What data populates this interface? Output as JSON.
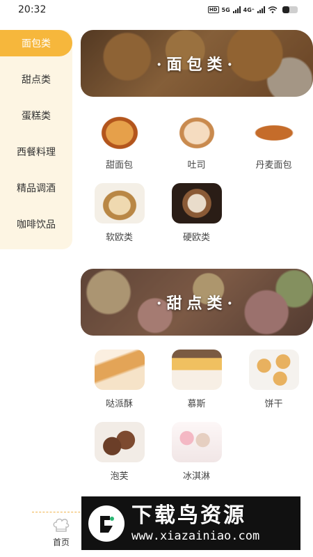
{
  "status_bar": {
    "time": "20:32",
    "network_badge": "HD",
    "net1": "5G",
    "net2": "4G⁺",
    "battery_level": 0.45
  },
  "sidebar": {
    "items": [
      {
        "label": "面包类",
        "active": true
      },
      {
        "label": "甜点类",
        "active": false
      },
      {
        "label": "蛋糕类",
        "active": false
      },
      {
        "label": "西餐料理",
        "active": false
      },
      {
        "label": "精品调酒",
        "active": false
      },
      {
        "label": "咖啡饮品",
        "active": false
      }
    ]
  },
  "sections": [
    {
      "banner_title": "·面包类·",
      "items": [
        {
          "label": "甜面包",
          "icon": "sweet-bread-image"
        },
        {
          "label": "吐司",
          "icon": "toast-image"
        },
        {
          "label": "丹麦面包",
          "icon": "croissant-image"
        },
        {
          "label": "软欧类",
          "icon": "soft-european-bread-image"
        },
        {
          "label": "硬欧类",
          "icon": "hard-european-bread-image"
        }
      ]
    },
    {
      "banner_title": "·甜点类·",
      "items": [
        {
          "label": "哒派酥",
          "icon": "pastry-roll-image"
        },
        {
          "label": "慕斯",
          "icon": "mousse-image"
        },
        {
          "label": "饼干",
          "icon": "biscuit-image"
        },
        {
          "label": "泡芙",
          "icon": "cream-puff-image"
        },
        {
          "label": "冰淇淋",
          "icon": "ice-cream-image"
        }
      ]
    }
  ],
  "tab_bar": {
    "home_label": "首页",
    "home_icon": "chef-hat-icon"
  },
  "watermark": {
    "title": "下载鸟资源",
    "url": "www.xiazainiao.com"
  },
  "colors": {
    "accent": "#f6b73c",
    "sidebar_bg": "#fdf5e3",
    "divider": "#f0b24a"
  }
}
